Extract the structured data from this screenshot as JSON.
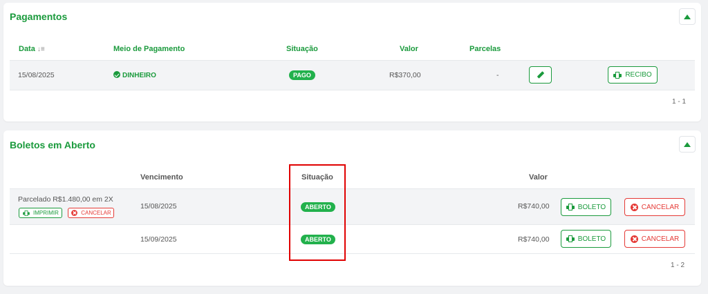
{
  "pagamentos": {
    "title": "Pagamentos",
    "headers": {
      "data": "Data",
      "meio": "Meio de Pagamento",
      "situacao": "Situação",
      "valor": "Valor",
      "parcelas": "Parcelas"
    },
    "row": {
      "data": "15/08/2025",
      "meio": "DINHEIRO",
      "situacao": "PAGO",
      "valor": "R$370,00",
      "parcelas": "-",
      "recibo_label": "RECIBO"
    },
    "pager": "1 - 1"
  },
  "boletos": {
    "title": "Boletos em Aberto",
    "headers": {
      "vencimento": "Vencimento",
      "situacao": "Situação",
      "valor": "Valor"
    },
    "parcelado_text": "Parcelado R$1.480,00 em 2X",
    "imprimir_label": "IMPRIMIR",
    "cancelar_small_label": "CANCELAR",
    "rows": [
      {
        "vencimento": "15/08/2025",
        "situacao": "ABERTO",
        "valor": "R$740,00",
        "boleto_label": "BOLETO",
        "cancelar_label": "CANCELAR"
      },
      {
        "vencimento": "15/09/2025",
        "situacao": "ABERTO",
        "valor": "R$740,00",
        "boleto_label": "BOLETO",
        "cancelar_label": "CANCELAR"
      }
    ],
    "pager": "1 - 2"
  },
  "colors": {
    "brand_green": "#1a9a3c",
    "badge_green": "#22b14c",
    "danger_red": "#e53935",
    "highlight_red": "#e00000"
  }
}
